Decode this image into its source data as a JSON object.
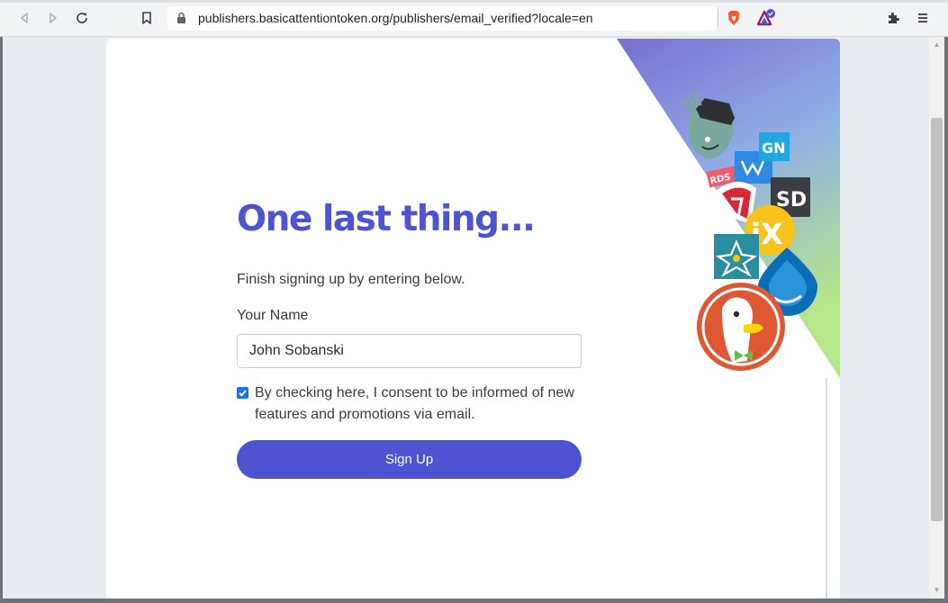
{
  "browser": {
    "url": "publishers.basicattentiontoken.org/publishers/email_verified?locale=en",
    "icons": [
      "back-icon",
      "forward-icon",
      "reload-icon",
      "bookmark-icon",
      "lock-icon",
      "brave-shields-icon",
      "brave-rewards-icon",
      "extensions-icon",
      "menu-icon"
    ]
  },
  "form": {
    "headline": "One last thing...",
    "subtitle": "Finish signing up by entering below.",
    "name_label": "Your Name",
    "name_value": "John Sobanski",
    "consent_checked": true,
    "consent_text": "By checking here, I consent to be informed of new features and promotions via email.",
    "submit_label": "Sign Up"
  },
  "decor": {
    "logo_texts": [
      "GN",
      "SD",
      "iX",
      "RDS"
    ]
  },
  "colors": {
    "accent": "#4c54d2",
    "checkbox": "#1a73e8",
    "gradient_top": "#7b6fd0",
    "gradient_bottom": "#b8e68a"
  }
}
